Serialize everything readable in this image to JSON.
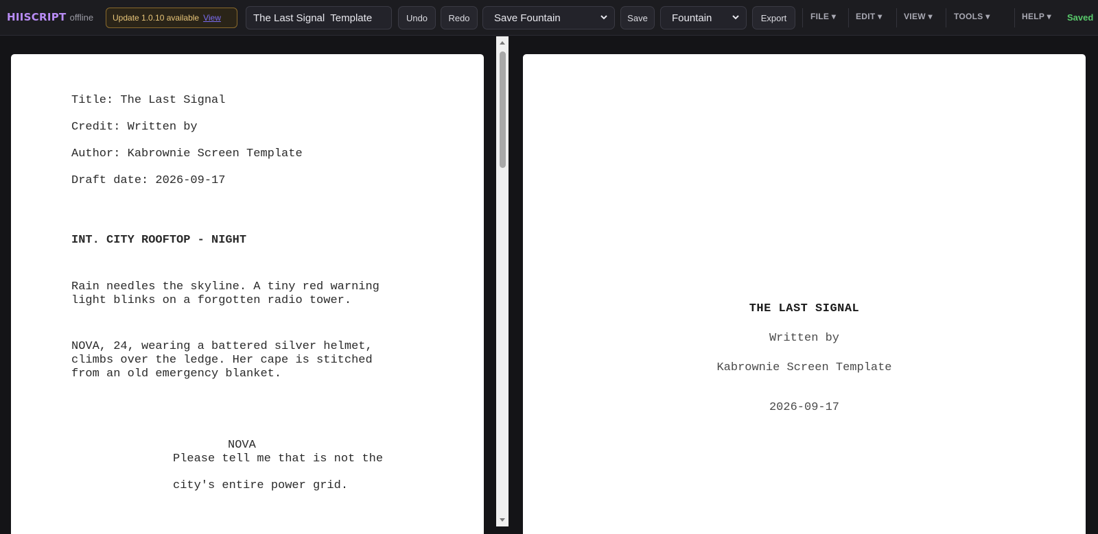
{
  "app": {
    "name": "HIISCRIPT",
    "status": "offline"
  },
  "update": {
    "text": "Update 1.0.10 available",
    "link": "View"
  },
  "document_title": "The Last Signal  Template",
  "toolbar": {
    "undo": "Undo",
    "redo": "Redo",
    "save_format": "Save Fountain",
    "save": "Save",
    "export_format": "Fountain",
    "export": "Export"
  },
  "menus": [
    "FILE ▾",
    "EDIT ▾",
    "VIEW ▾",
    "TOOLS ▾",
    "HELP ▾"
  ],
  "save_status": "Saved",
  "editor": {
    "title_page": [
      "Title: The Last Signal",
      "Credit: Written by",
      "Author: Kabrownie Screen Template",
      "Draft date: 2026-09-17"
    ],
    "scene_heading": "INT. CITY ROOFTOP - NIGHT",
    "action_1": [
      "Rain needles the skyline. A tiny red warning",
      "light blinks on a forgotten radio tower."
    ],
    "action_2": [
      "NOVA, 24, wearing a battered silver helmet,",
      "climbs over the ledge. Her cape is stitched",
      "from an old emergency blanket."
    ],
    "character": "NOVA",
    "dialogue": [
      "Please tell me that is not the",
      "city's entire power grid."
    ]
  },
  "preview": {
    "title": "THE LAST SIGNAL",
    "credit": "Written by",
    "author": "Kabrownie Screen Template",
    "date": "2026-09-17"
  },
  "colors": {
    "brand": "#b98cf5",
    "saved": "#58c96b",
    "update_text": "#e9c67a",
    "update_link": "#7a6cf0"
  }
}
